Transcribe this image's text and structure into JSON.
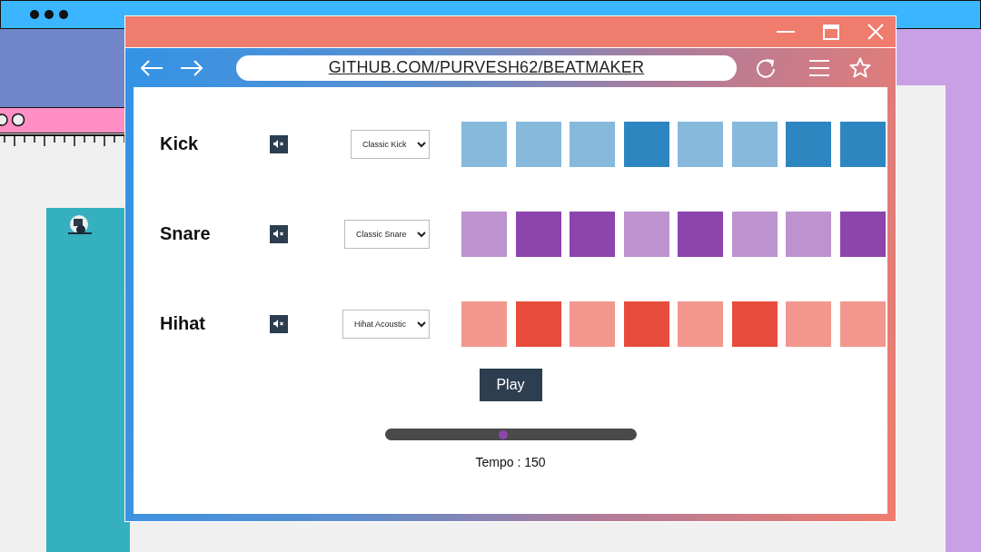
{
  "browser": {
    "url": "GITHUB.COM/PURVESH62/BEATMAKER"
  },
  "tracks": [
    {
      "name": "Kick",
      "sound": "Classic Kick",
      "color": "#2e86c1",
      "pads": [
        {
          "on": false
        },
        {
          "on": false
        },
        {
          "on": false
        },
        {
          "on": true
        },
        {
          "on": false
        },
        {
          "on": false
        },
        {
          "on": true
        },
        {
          "on": true
        }
      ]
    },
    {
      "name": "Snare",
      "sound": "Classic Snare",
      "color": "#8e44ad",
      "pads": [
        {
          "on": false
        },
        {
          "on": true
        },
        {
          "on": true
        },
        {
          "on": false
        },
        {
          "on": true
        },
        {
          "on": false
        },
        {
          "on": false
        },
        {
          "on": true
        }
      ]
    },
    {
      "name": "Hihat",
      "sound": "Hihat Acoustic",
      "color": "#e74c3c",
      "pads": [
        {
          "on": false
        },
        {
          "on": true
        },
        {
          "on": false
        },
        {
          "on": true
        },
        {
          "on": false
        },
        {
          "on": true
        },
        {
          "on": false
        },
        {
          "on": false
        }
      ]
    }
  ],
  "play_button": "Play",
  "tempo": {
    "level": 0.47,
    "label": "Tempo : 150"
  }
}
